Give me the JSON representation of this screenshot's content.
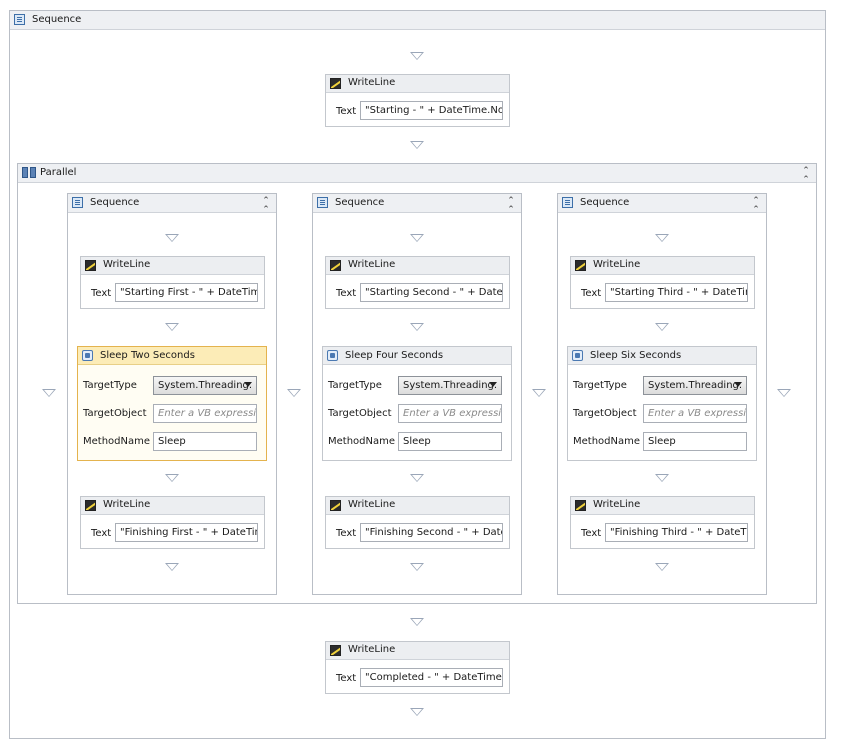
{
  "outer": {
    "title": "Sequence",
    "icon": "sequence-icon"
  },
  "parallel": {
    "title": "Parallel",
    "icon": "parallel-icon",
    "collapse_icon": "collapse-icon"
  },
  "writelines": {
    "start": {
      "title": "WriteLine",
      "label": "Text",
      "value": "\"Starting - \" + DateTime.Now"
    },
    "done": {
      "title": "WriteLine",
      "label": "Text",
      "value": "\"Completed - \" + DateTime.N"
    }
  },
  "branches": [
    {
      "title": "Sequence",
      "write_start": {
        "title": "WriteLine",
        "label": "Text",
        "value": "\"Starting First - \" + DateTime."
      },
      "invoke": {
        "title": "Sleep Two Seconds",
        "target_type_label": "TargetType",
        "target_type_value": "System.Threading.",
        "target_object_label": "TargetObject",
        "target_object_placeholder": "Enter a VB expression",
        "method_label": "MethodName",
        "method_value": "Sleep"
      },
      "write_end": {
        "title": "WriteLine",
        "label": "Text",
        "value": "\"Finishing First - \" + DateTime"
      }
    },
    {
      "title": "Sequence",
      "write_start": {
        "title": "WriteLine",
        "label": "Text",
        "value": "\"Starting Second - \" + DateTi"
      },
      "invoke": {
        "title": "Sleep Four Seconds",
        "target_type_label": "TargetType",
        "target_type_value": "System.Threading.",
        "target_object_label": "TargetObject",
        "target_object_placeholder": "Enter a VB expression",
        "method_label": "MethodName",
        "method_value": "Sleep"
      },
      "write_end": {
        "title": "WriteLine",
        "label": "Text",
        "value": "\"Finishing Second - \" + DateT"
      }
    },
    {
      "title": "Sequence",
      "write_start": {
        "title": "WriteLine",
        "label": "Text",
        "value": "\"Starting Third - \" + DateTime"
      },
      "invoke": {
        "title": "Sleep Six Seconds",
        "target_type_label": "TargetType",
        "target_type_value": "System.Threading.",
        "target_object_label": "TargetObject",
        "target_object_placeholder": "Enter a VB expression",
        "method_label": "MethodName",
        "method_value": "Sleep"
      },
      "write_end": {
        "title": "WriteLine",
        "label": "Text",
        "value": "\"Finishing Third - \" + DateTim"
      }
    }
  ],
  "colors": {
    "selected_border": "#e4b34e",
    "selected_header": "#fcecb7",
    "frame_border": "#b9bec6",
    "drop_arrow": "#9aa6b8"
  }
}
